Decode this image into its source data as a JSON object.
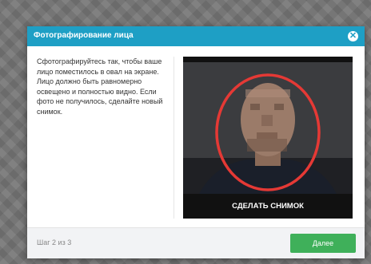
{
  "dialog": {
    "title": "Фотографирование лица",
    "close_icon": "close-icon"
  },
  "instructions": "Сфотографируйтесь так, чтобы ваше лицо поместилось в овал на экране. Лицо должно быть равномерно освещено и полностью видно. Если фото не получилось, сделайте новый снимок.",
  "camera": {
    "snapshot_label": "СДЕЛАТЬ СНИМОК",
    "oval_color": "#e53935"
  },
  "footer": {
    "step_text": "Шаг 2 из 3",
    "next_label": "Далее"
  },
  "colors": {
    "header": "#1e9fc5",
    "next_button": "#3fb05a"
  }
}
